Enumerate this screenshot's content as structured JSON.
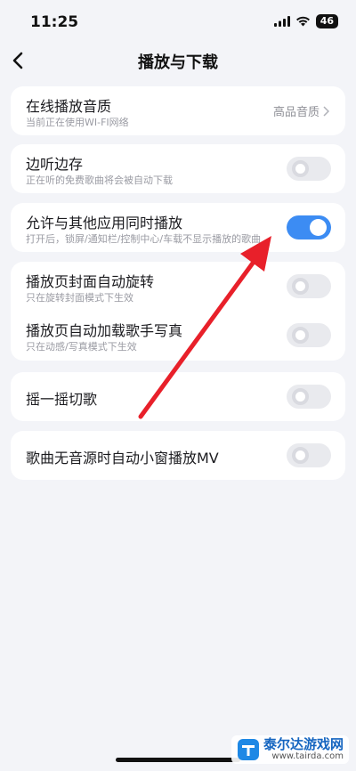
{
  "status": {
    "time": "11:25",
    "battery": "46"
  },
  "header": {
    "title": "播放与下载"
  },
  "cards": {
    "quality": {
      "title": "在线播放音质",
      "subtitle": "当前正在使用WI-FI网络",
      "value": "高品音质"
    },
    "cache": {
      "title": "边听边存",
      "subtitle": "正在听的免费歌曲将会被自动下载",
      "on": false
    },
    "mix": {
      "title": "允许与其他应用同时播放",
      "subtitle": "打开后，锁屏/通知栏/控制中心/车载不显示播放的歌曲",
      "on": true
    },
    "rotate": {
      "title": "播放页封面自动旋转",
      "subtitle": "只在旋转封面模式下生效",
      "on": false
    },
    "photo": {
      "title": "播放页自动加载歌手写真",
      "subtitle": "只在动感/写真模式下生效",
      "on": false
    },
    "shake": {
      "title": "摇一摇切歌",
      "on": false
    },
    "mv": {
      "title": "歌曲无音源时自动小窗播放MV",
      "on": false
    }
  },
  "colors": {
    "accent": "#3c8cf3",
    "arrow": "#e8202a"
  },
  "watermark": {
    "name": "泰尔达游戏网",
    "url": "www.tairda.com"
  }
}
